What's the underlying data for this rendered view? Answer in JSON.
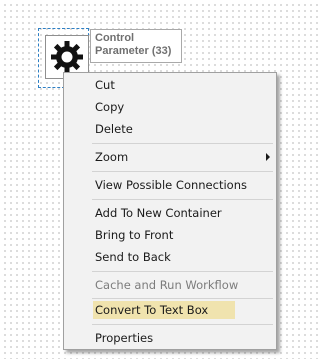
{
  "tool": {
    "label_line1": "Control",
    "label_line2": "Parameter (33)",
    "icon": "gear-icon"
  },
  "menu": {
    "cut": "Cut",
    "copy": "Copy",
    "delete": "Delete",
    "zoom": "Zoom",
    "view_connections": "View Possible Connections",
    "add_container": "Add To New Container",
    "bring_front": "Bring to Front",
    "send_back": "Send to Back",
    "cache_run": "Cache and Run Workflow",
    "convert_textbox": "Convert To Text Box",
    "properties": "Properties"
  },
  "colors": {
    "highlight": "#f0e3ae",
    "selection_border": "#2d7fc4",
    "menu_background": "#f2f2f2"
  }
}
